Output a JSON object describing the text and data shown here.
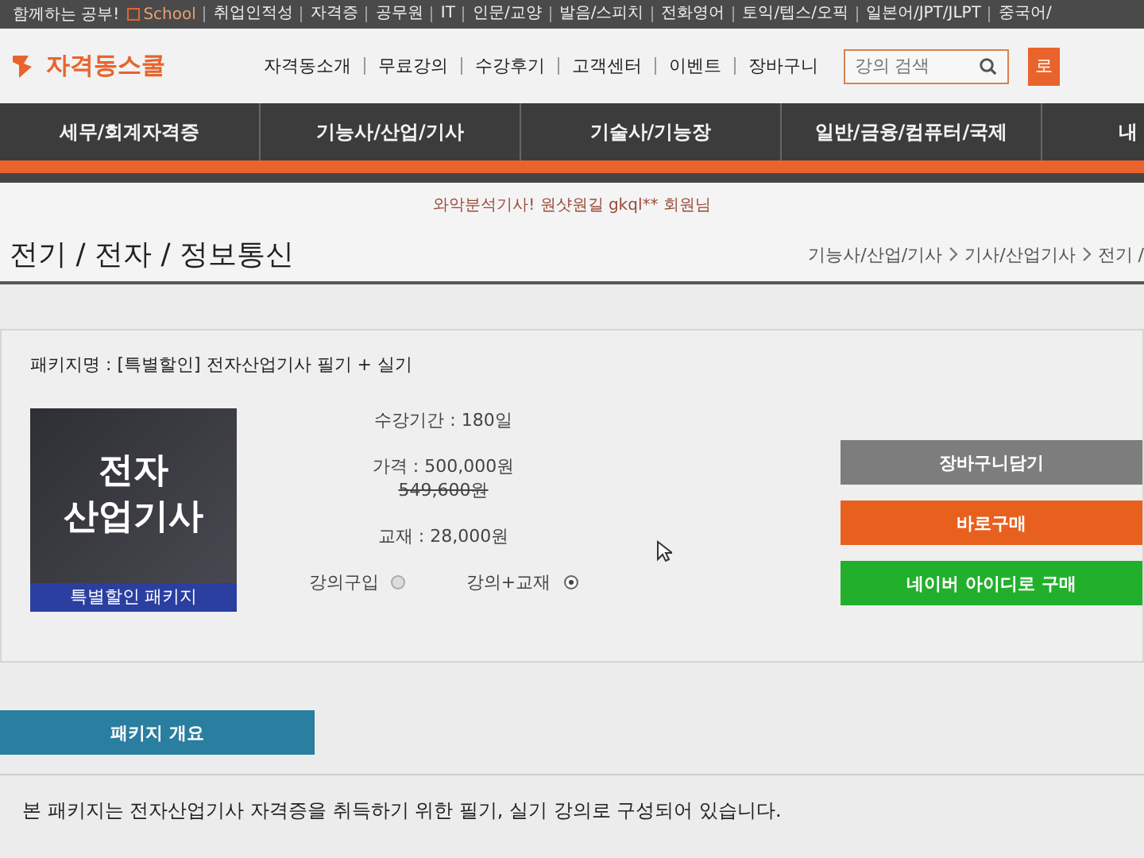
{
  "top_bar": {
    "lead": "함께하는 공부!",
    "brand": "School",
    "links": [
      "취업인적성",
      "자격증",
      "공무원",
      "IT",
      "인문/교양",
      "발음/스피치",
      "전화영어",
      "토익/텝스/오픽",
      "일본어/JPT/JLPT",
      "중국어/"
    ]
  },
  "header": {
    "logo": "자격동스쿨",
    "menu": [
      "자격동소개",
      "무료강의",
      "수강후기",
      "고객센터",
      "이벤트",
      "장바구니"
    ],
    "search": {
      "placeholder": "강의 검색"
    },
    "side_button": "로"
  },
  "nav": {
    "items": [
      "세무/회계자격증",
      "기능사/산업/기사",
      "기술사/기능장",
      "일반/금융/컴퓨터/국제",
      "내"
    ]
  },
  "marquee": "와악분석기사! 원샷원길 gkql** 회원님",
  "page_title": "전기 / 전자 / 정보통신",
  "breadcrumb": [
    "기능사/산업/기사",
    "기사/산업기사",
    "전기 /"
  ],
  "package": {
    "name": "패키지명 : [특별할인] 전자산업기사 필기 + 실기",
    "cover": {
      "title_lines": [
        "전자",
        "산업기사"
      ],
      "ribbon": "특별할인 패키지"
    },
    "period": "수강기간 : 180일",
    "price": "가격 : 500,000원",
    "old_price": "549,600원",
    "book": "교재 : 28,000원",
    "options": [
      {
        "label": "강의구입",
        "selected": false
      },
      {
        "label": "강의+교재",
        "selected": true
      }
    ],
    "buttons": [
      {
        "label": "장바구니담기",
        "kind": "cart"
      },
      {
        "label": "바로구매",
        "kind": "buy"
      },
      {
        "label": "네이버 아이디로 구매",
        "kind": "naver"
      }
    ]
  },
  "overview_tab": "패키지 개요",
  "overview_text": "본 패키지는 전자산업기사 자격증을 취득하기 위한 필기, 실기 강의로 구성되어 있습니다."
}
